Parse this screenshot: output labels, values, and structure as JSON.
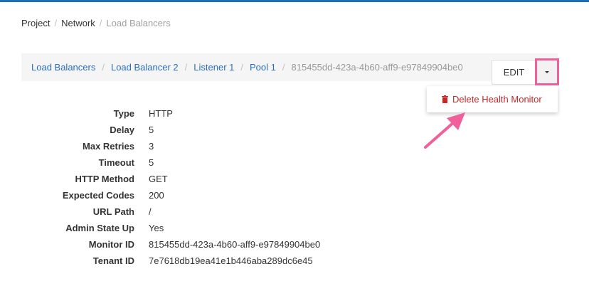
{
  "top_breadcrumb": {
    "items": [
      "Project",
      "Network",
      "Load Balancers"
    ],
    "separator": "/"
  },
  "detail_breadcrumb": {
    "links": [
      "Load Balancers",
      "Load Balancer 2",
      "Listener 1",
      "Pool 1"
    ],
    "current": "815455dd-423a-4b60-aff9-e97849904be0",
    "separator": "/"
  },
  "actions": {
    "edit_label": "EDIT",
    "dropdown_items": [
      "Delete Health Monitor"
    ]
  },
  "details": [
    {
      "label": "Type",
      "value": "HTTP"
    },
    {
      "label": "Delay",
      "value": "5"
    },
    {
      "label": "Max Retries",
      "value": "3"
    },
    {
      "label": "Timeout",
      "value": "5"
    },
    {
      "label": "HTTP Method",
      "value": "GET"
    },
    {
      "label": "Expected Codes",
      "value": "200"
    },
    {
      "label": "URL Path",
      "value": "/"
    },
    {
      "label": "Admin State Up",
      "value": "Yes"
    },
    {
      "label": "Monitor ID",
      "value": "815455dd-423a-4b60-aff9-e97849904be0"
    },
    {
      "label": "Tenant ID",
      "value": "7e7618db19ea41e1b446aba289dc6e45"
    }
  ],
  "colors": {
    "link": "#2a6ebb",
    "danger": "#c62828",
    "highlight": "#f0609a",
    "top_bar": "#1f6fb2"
  },
  "icons": {
    "delete_item": "trash-icon",
    "split_toggle": "caret-down-icon",
    "annotation": "arrow-annotation"
  }
}
